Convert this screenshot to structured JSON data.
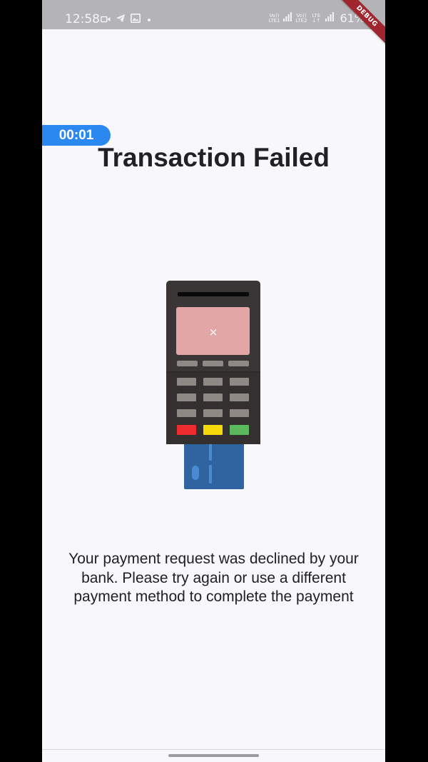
{
  "status_bar": {
    "time": "12:58",
    "network1": [
      "Vo))",
      "LTE1"
    ],
    "network2": [
      "Vo))",
      "LTE2"
    ],
    "network3": [
      "LTE",
      "↓↑"
    ],
    "battery": "61%",
    "icons": [
      "video-icon",
      "telegram-icon",
      "gallery-icon",
      "dot-icon",
      "signal-icon",
      "signal-icon"
    ]
  },
  "debug_banner": "DEBUG",
  "timer": "00:01",
  "title": "Transaction Failed",
  "illustration": {
    "icon": "card-terminal-declined-icon",
    "screen_symbol": "×",
    "colors": {
      "terminal": "#3a3635",
      "screen": "#e3a6a7",
      "red_key": "#ee2b2e",
      "yellow_key": "#f6d90b",
      "green_key": "#5cb85c",
      "card": "#2f64a0"
    }
  },
  "message": {
    "line1": "Your payment request was declined by your",
    "line2": "bank. Please try again or use a different",
    "line3": "payment method to complete the payment"
  }
}
